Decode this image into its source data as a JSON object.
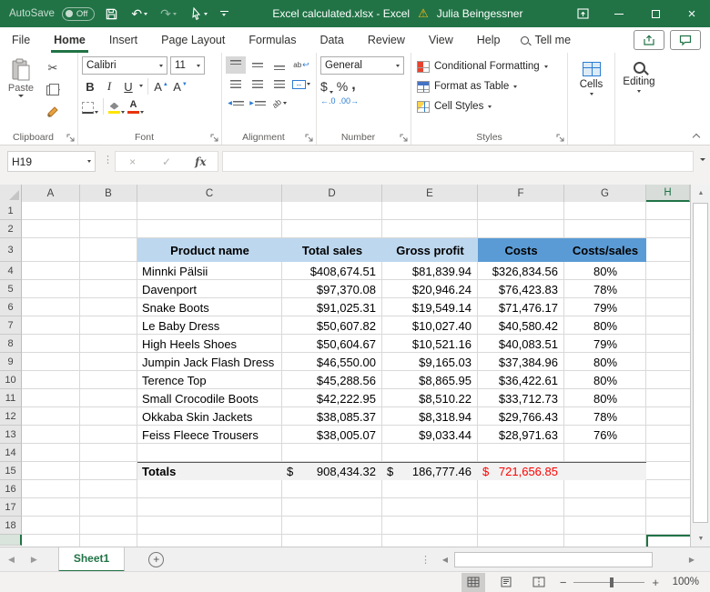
{
  "titlebar": {
    "autosave_label": "AutoSave",
    "autosave_state": "Off",
    "title": "Excel calculated.xlsx  -  Excel",
    "user": "Julia Beingessner"
  },
  "ribbon_tabs": {
    "items": [
      {
        "label": "File"
      },
      {
        "label": "Home"
      },
      {
        "label": "Insert"
      },
      {
        "label": "Page Layout"
      },
      {
        "label": "Formulas"
      },
      {
        "label": "Data"
      },
      {
        "label": "Review"
      },
      {
        "label": "View"
      },
      {
        "label": "Help"
      }
    ],
    "active": "Home",
    "tell_me": "Tell me"
  },
  "ribbon": {
    "clipboard": {
      "label": "Clipboard",
      "paste": "Paste"
    },
    "font": {
      "label": "Font",
      "font_name": "Calibri",
      "font_size": "11",
      "bold": "B",
      "italic": "I",
      "underline": "U",
      "grow_letter": "A",
      "shrink_letter": "A",
      "color_letter": "A"
    },
    "alignment": {
      "label": "Alignment",
      "wrap_text": "ab",
      "orientation_text": "ab"
    },
    "number": {
      "label": "Number",
      "format": "General",
      "currency": "$",
      "percent": "%",
      "comma": ",",
      "inc_decimal": "←.0",
      "dec_decimal": ".00→"
    },
    "styles": {
      "label": "Styles",
      "items": [
        {
          "label": "Conditional Formatting"
        },
        {
          "label": "Format as Table"
        },
        {
          "label": "Cell Styles"
        }
      ]
    },
    "cells": {
      "label": "Cells"
    },
    "editing": {
      "label": "Editing"
    }
  },
  "formula_bar": {
    "name_box": "H19",
    "fx_label": "fx",
    "formula_value": ""
  },
  "grid": {
    "columns": [
      "A",
      "B",
      "C",
      "D",
      "E",
      "F",
      "G",
      "H"
    ],
    "rows": [
      "1",
      "2",
      "3",
      "4",
      "5",
      "6",
      "7",
      "8",
      "9",
      "10",
      "11",
      "12",
      "13",
      "14",
      "15",
      "16",
      "17",
      "18"
    ],
    "selected_column": "H",
    "selected_cell": "H19"
  },
  "sheet_table": {
    "headers": [
      "Product name",
      "Total sales",
      "Gross profit",
      "Costs",
      "Costs/sales"
    ],
    "rows": [
      [
        "Minnki Pälsii",
        "$408,674.51",
        "$81,839.94",
        "$326,834.56",
        "80%"
      ],
      [
        "Davenport",
        "$97,370.08",
        "$20,946.24",
        "$76,423.83",
        "78%"
      ],
      [
        "Snake Boots",
        "$91,025.31",
        "$19,549.14",
        "$71,476.17",
        "79%"
      ],
      [
        "Le Baby Dress",
        "$50,607.82",
        "$10,027.40",
        "$40,580.42",
        "80%"
      ],
      [
        "High Heels Shoes",
        "$50,604.67",
        "$10,521.16",
        "$40,083.51",
        "79%"
      ],
      [
        "Jumpin Jack Flash Dress",
        "$46,550.00",
        "$9,165.03",
        "$37,384.96",
        "80%"
      ],
      [
        "Terence Top",
        "$45,288.56",
        "$8,865.95",
        "$36,422.61",
        "80%"
      ],
      [
        "Small Crocodile Boots",
        "$42,222.95",
        "$8,510.22",
        "$33,712.73",
        "80%"
      ],
      [
        "Okkaba Skin Jackets",
        "$38,085.37",
        "$8,318.94",
        "$29,766.43",
        "78%"
      ],
      [
        "Feiss Fleece Trousers",
        "$38,005.07",
        "$9,033.44",
        "$28,971.63",
        "76%"
      ]
    ],
    "totals": {
      "label": "Totals",
      "cells": [
        {
          "currency": "$",
          "value": "908,434.32",
          "color": "#000000"
        },
        {
          "currency": "$",
          "value": "186,777.46",
          "color": "#000000"
        },
        {
          "currency": "$",
          "value": "721,656.85",
          "color": "#FF0000"
        }
      ]
    }
  },
  "sheet_bar": {
    "active_sheet": "Sheet1"
  },
  "status_bar": {
    "zoom_level": "100%"
  },
  "icons": {
    "undo": "↶",
    "redo": "↷",
    "scissors": "✂",
    "warning": "⚠",
    "cancel": "×",
    "enter": "✓",
    "close": "×",
    "up": "▲",
    "down": "▼",
    "left": "◀",
    "right": "▶",
    "vdots": "⋮",
    "merge_arrow": "↔",
    "wrap_arrow": "↩",
    "minus": "−",
    "plus": "+",
    "grow_caret": "▲",
    "shrink_caret": "▼"
  },
  "colors": {
    "brand_green": "#217346",
    "table_header_light_blue": "#BDD7EE",
    "table_header_dark_blue": "#5B9BD5",
    "totals_background": "#F2F2F2",
    "totals_red": "#FF0000",
    "fill_color_yellow": "#FFE400",
    "font_color_red": "#E8340C"
  }
}
